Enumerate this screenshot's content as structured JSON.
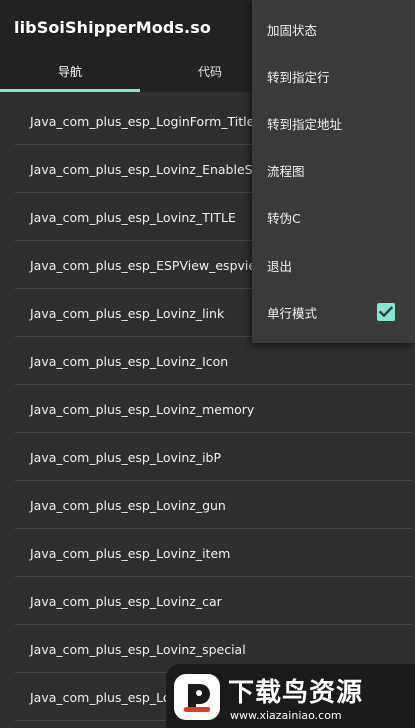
{
  "app": {
    "title": "libSoiShipperMods.so"
  },
  "tabs": [
    {
      "label": "导航",
      "active": true
    },
    {
      "label": "代码",
      "active": false
    }
  ],
  "list": {
    "items": [
      "Java_com_plus_esp_LoginForm_Title",
      "Java_com_plus_esp_Lovinz_EnableSou",
      "Java_com_plus_esp_Lovinz_TITLE",
      "Java_com_plus_esp_ESPView_espview",
      "Java_com_plus_esp_Lovinz_link",
      "Java_com_plus_esp_Lovinz_Icon",
      "Java_com_plus_esp_Lovinz_memory",
      "Java_com_plus_esp_Lovinz_ibP",
      "Java_com_plus_esp_Lovinz_gun",
      "Java_com_plus_esp_Lovinz_item",
      "Java_com_plus_esp_Lovinz_car",
      "Java_com_plus_esp_Lovinz_special",
      "Java_com_plus_esp_Lov"
    ]
  },
  "menu": {
    "items": [
      {
        "label": "加固状态"
      },
      {
        "label": "转到指定行"
      },
      {
        "label": "转到指定地址"
      },
      {
        "label": "流程图"
      },
      {
        "label": "转伪C"
      },
      {
        "label": "退出"
      },
      {
        "label": "单行模式",
        "checked": true
      }
    ]
  },
  "watermark": {
    "title": "下载鸟资源",
    "url": "www.xiazainiao.com"
  },
  "colors": {
    "accent": "#7fe7d3",
    "appbar": "#222222",
    "background": "#2f2f2f",
    "menu": "#3a3a3a"
  }
}
